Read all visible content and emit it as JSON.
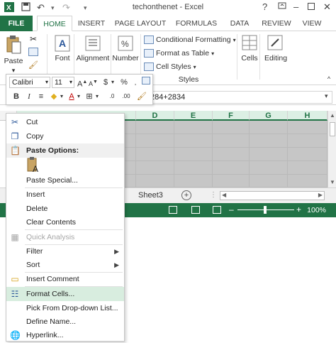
{
  "window": {
    "title": "techonthenet - Excel",
    "help_label": "?"
  },
  "ribbon_tabs": [
    {
      "label": "FILE"
    },
    {
      "label": "HOME"
    },
    {
      "label": "INSERT"
    },
    {
      "label": "PAGE LAYOUT"
    },
    {
      "label": "FORMULAS"
    },
    {
      "label": "DATA"
    },
    {
      "label": "REVIEW"
    },
    {
      "label": "VIEW"
    }
  ],
  "ribbon": {
    "paste_label": "Paste",
    "font_label": "Font",
    "alignment_label": "Alignment",
    "number_label": "Number",
    "conditional_formatting": "Conditional Formatting",
    "format_as_table": "Format as Table",
    "cell_styles": "Cell Styles",
    "styles_group_label": "Styles",
    "cells_label": "Cells",
    "editing_label": "Editing",
    "percent_symbol": "%"
  },
  "mini_toolbar": {
    "font_name": "Calibri",
    "font_size": "11",
    "currency_symbol": "$",
    "percent_symbol": "%",
    "bold": "B",
    "italic": "I",
    "increase_font": "A",
    "decrease_font": "A"
  },
  "formula_bar": {
    "formula_text": "284+2834"
  },
  "columns": [
    "D",
    "E",
    "F",
    "G",
    "H"
  ],
  "sheet": {
    "name": "Sheet3"
  },
  "status": {
    "zoom": "100%"
  },
  "colors": {
    "excel_green": "#217346",
    "selected_cell": "#c6c6c6",
    "highlight": "#d8eddf"
  },
  "context_menu": {
    "cut": "Cut",
    "copy": "Copy",
    "paste_options": "Paste Options:",
    "paste_special": "Paste Special...",
    "insert": "Insert",
    "delete": "Delete",
    "clear_contents": "Clear Contents",
    "quick_analysis": "Quick Analysis",
    "filter": "Filter",
    "sort": "Sort",
    "insert_comment": "Insert Comment",
    "format_cells": "Format Cells...",
    "pick_from_dropdown": "Pick From Drop-down List...",
    "define_name": "Define Name...",
    "hyperlink": "Hyperlink..."
  }
}
